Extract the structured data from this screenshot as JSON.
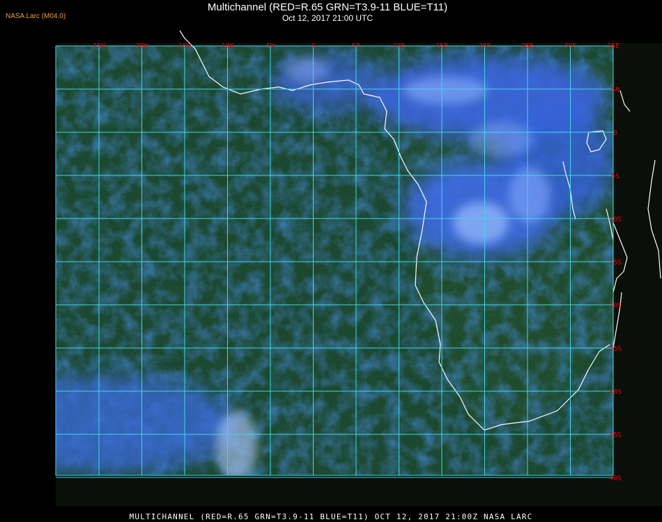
{
  "header": {
    "agency_label": "NASA Larc (M04.0)",
    "title": "Multichannel (RED=R.65 GRN=T3.9-11 BLUE=T11)",
    "subtitle": "Oct 12, 2017 21:00 UTC"
  },
  "map": {
    "longitude_labels": [
      "25W",
      "20W",
      "15W",
      "10W",
      "5W",
      "0",
      "5E",
      "10E",
      "15E",
      "20E",
      "25E",
      "30E",
      "35E"
    ],
    "latitude_labels": [
      "5N",
      "0",
      "5S",
      "10S",
      "15S",
      "20S",
      "25S",
      "30S",
      "35S",
      "40S"
    ],
    "colors": {
      "grid": "#3fd9e6",
      "label": "#cc1010",
      "coast": "#ffffff",
      "ocean": "#1b4a2c",
      "cloud": "#2b56d6",
      "high_cloud": "#9ec0ff"
    }
  },
  "footer": {
    "caption": "MULTICHANNEL (RED=R.65 GRN=T3.9-11 BLUE=T11) OCT 12, 2017 21:00Z   NASA LARC"
  }
}
